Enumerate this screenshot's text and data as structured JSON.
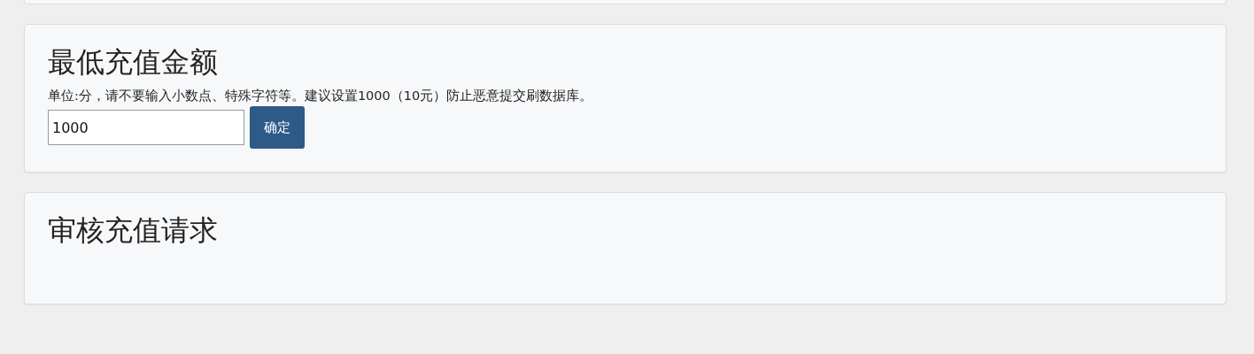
{
  "sections": [
    {
      "title": "最低充值金额",
      "description": "单位:分，请不要输入小数点、特殊字符等。建议设置1000（10元）防止恶意提交刷数据库。",
      "input": {
        "value": "1000"
      },
      "button": "确定"
    },
    {
      "title": "审核充值请求"
    }
  ]
}
